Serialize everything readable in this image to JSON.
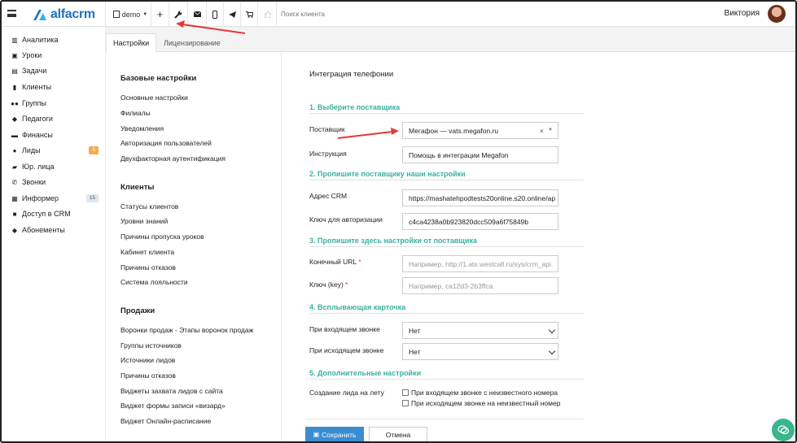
{
  "topbar": {
    "logo": "alfacrm",
    "branch": "demo",
    "search_placeholder": "Поиск клиента",
    "user_name": "Виктория"
  },
  "sidebar": {
    "items": [
      {
        "label": "Аналитика",
        "icon": "analytics-icon"
      },
      {
        "label": "Уроки",
        "icon": "calendar-icon"
      },
      {
        "label": "Задачи",
        "icon": "tasks-icon"
      },
      {
        "label": "Клиенты",
        "icon": "clients-icon"
      },
      {
        "label": "Группы",
        "icon": "groups-icon"
      },
      {
        "label": "Педагоги",
        "icon": "teachers-icon"
      },
      {
        "label": "Финансы",
        "icon": "finance-icon"
      },
      {
        "label": "Лиды",
        "icon": "leads-icon",
        "badge": "5"
      },
      {
        "label": "Юр. лица",
        "icon": "legal-entities-icon"
      },
      {
        "label": "Звонки",
        "icon": "calls-icon"
      },
      {
        "label": "Информер",
        "icon": "informer-icon",
        "badge": "15"
      },
      {
        "label": "Доступ в CRM",
        "icon": "lock-icon"
      },
      {
        "label": "Абонементы",
        "icon": "tag-icon"
      }
    ]
  },
  "tabs": [
    {
      "label": "Настройки",
      "active": true
    },
    {
      "label": "Лицензирование",
      "active": false
    }
  ],
  "menu": {
    "basic": {
      "title": "Базовые настройки",
      "items": [
        "Основные настройки",
        "Филиалы",
        "Уведомления",
        "Авторизация пользователей",
        "Двухфакторная аутентификация"
      ]
    },
    "clients": {
      "title": "Клиенты",
      "items": [
        "Статусы клиентов",
        "Уровни знаний",
        "Причины пропуска уроков",
        "Кабинет клиента",
        "Причины отказов",
        "Система лояльности"
      ]
    },
    "sales": {
      "title": "Продажи",
      "items": [
        "Воронки продаж - Этапы воронок продаж",
        "Группы источников",
        "Источники лидов",
        "Причины отказов",
        "Виджеты захвата лидов с сайта",
        "Виджет формы записи «визард»",
        "Виджет Онлайн-расписание"
      ]
    }
  },
  "form": {
    "title": "Интеграция телефонии",
    "s1": "1. Выберите поставщика",
    "provider_label": "Поставщик",
    "provider_value": "Мегафон — vats.megafon.ru",
    "instruction_label": "Инструкция",
    "instruction_value": "Помощь в интеграции Megafon",
    "s2": "2. Пропишите поставщику наши настройки",
    "crm_address_label": "Адрес CRM",
    "crm_address_value": "https://mashatehpodtests20online.s20.online/ap",
    "auth_key_label": "Ключ для авторизации",
    "auth_key_value": "c4ca4238a0b923820dcc509a6f75849b",
    "s3": "3. Пропишите здесь настройки от поставщика",
    "endpoint_label": "Конечный URL",
    "endpoint_placeholder": "Например, http://1.ats.westcall.ru/sys/crm_api.",
    "key_label": "Ключ (key)",
    "key_placeholder": "Например, ca12d3-2b3ffca",
    "required_mark": "*",
    "s4": "4. Всплывающая карточка",
    "incoming_label": "При входящем звонке",
    "incoming_value": "Нет",
    "outgoing_label": "При исходящем звонке",
    "outgoing_value": "Нет",
    "s5": "5. Дополнительные настройки",
    "lead_label": "Создание лида на лету",
    "chk_incoming": "При входящем звонке с неизвестного номера",
    "chk_outgoing": "При исходящем звонке на неизвестный номер",
    "save": "Сохранить",
    "cancel": "Отмена"
  },
  "colors": {
    "accent": "#1e73be",
    "section": "#3ab0a2",
    "save_button": "#3b8dd0",
    "arrow": "#e53935",
    "chat": "#3ab58f",
    "badge_leads": "#f0ad4e",
    "badge_informer": "#dfe7ee"
  }
}
